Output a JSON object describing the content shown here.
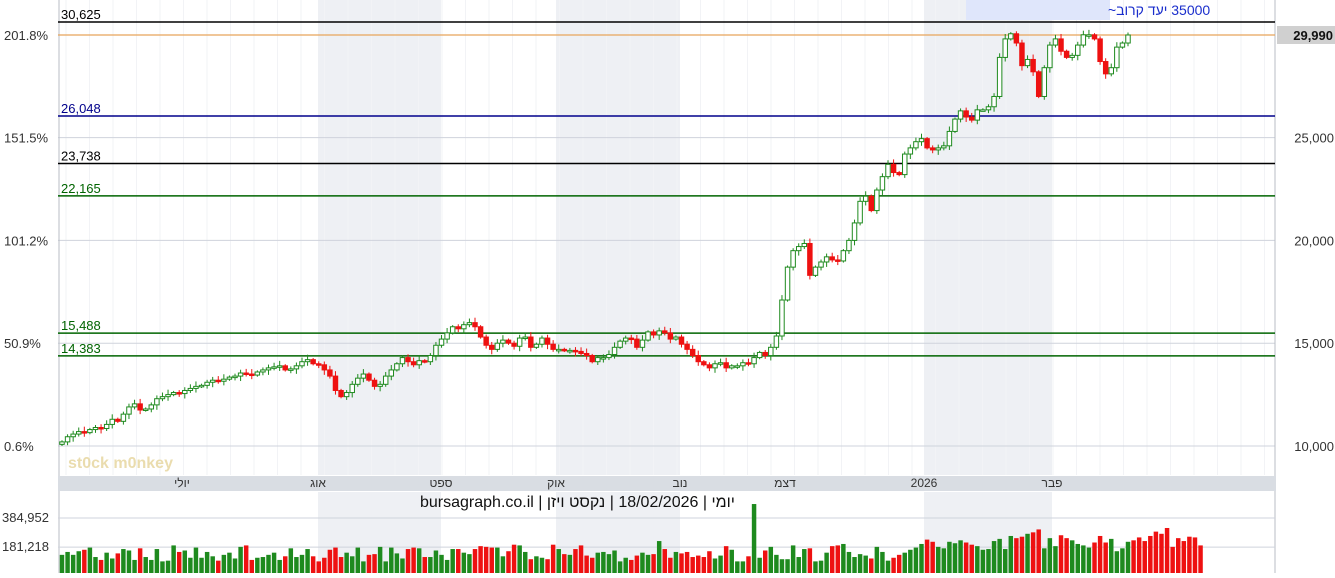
{
  "chart_data": {
    "type": "candlestick",
    "y_axis_right": {
      "ticks": [
        10000,
        15000,
        20000,
        25000,
        30000
      ],
      "tick_labels": [
        "10,000",
        "15,000",
        "20,000",
        "25,000",
        "29,990"
      ]
    },
    "y_axis_left": {
      "ticks": [
        10000,
        15000,
        20000,
        25000,
        29990
      ],
      "tick_labels": [
        "0.6%",
        "50.9%",
        "101.2%",
        "151.5%",
        "201.8%"
      ]
    },
    "ylim": [
      9900,
      30700
    ],
    "last_price": "29,990",
    "months": [
      "יולי",
      "אוג",
      "ספט",
      "אוק",
      "נוב",
      "דצמ",
      "2026",
      "פבר"
    ],
    "horizontal_levels": [
      {
        "value": 30625,
        "label": "30,625",
        "color": "#000000"
      },
      {
        "value": 26048,
        "label": "26,048",
        "color": "#00008b"
      },
      {
        "value": 23738,
        "label": "23,738",
        "color": "#000000"
      },
      {
        "value": 22165,
        "label": "22,165",
        "color": "#006400"
      },
      {
        "value": 15488,
        "label": "15,488",
        "color": "#006400"
      },
      {
        "value": 14383,
        "label": "14,383",
        "color": "#006400"
      }
    ],
    "highlight_level": {
      "value": 29990,
      "color": "#e8a55a"
    },
    "target_note": "35000 יעד קרוב~",
    "info_line": "יומי | 18/02/2026 | נקסט ויזן | bursagraph.co.il",
    "watermark": "st0ck m0nkey",
    "volume_ticks": {
      "labels": [
        "384,952",
        "181,218"
      ],
      "values": [
        384952,
        181218
      ]
    },
    "closes": [
      10200,
      10450,
      10580,
      10700,
      10650,
      10800,
      10900,
      10850,
      11050,
      11300,
      11200,
      11550,
      11900,
      12050,
      11750,
      11800,
      12000,
      12300,
      12400,
      12500,
      12600,
      12550,
      12700,
      12800,
      12900,
      12950,
      13100,
      13200,
      13150,
      13250,
      13350,
      13400,
      13550,
      13500,
      13450,
      13600,
      13700,
      13800,
      13850,
      13900,
      13700,
      13750,
      13900,
      14100,
      14200,
      14000,
      13950,
      13700,
      13400,
      12700,
      12400,
      12600,
      13000,
      13300,
      13500,
      13200,
      12900,
      13000,
      13400,
      13700,
      14000,
      14300,
      14100,
      13950,
      14150,
      14100,
      14400,
      14900,
      15200,
      15500,
      15800,
      15700,
      15900,
      16000,
      15800,
      15300,
      14900,
      14700,
      15000,
      15150,
      15000,
      14850,
      15250,
      15300,
      14800,
      14950,
      15250,
      14950,
      14700,
      14700,
      14650,
      14650,
      14600,
      14500,
      14400,
      14100,
      14300,
      14300,
      14450,
      14800,
      15100,
      15250,
      15200,
      14800,
      15150,
      15550,
      15400,
      15600,
      15500,
      15200,
      15300,
      14950,
      14700,
      14400,
      14100,
      13950,
      13800,
      14000,
      14050,
      13800,
      13900,
      13900,
      14050,
      14000,
      14300,
      14550,
      14400,
      14800,
      15350,
      17100,
      18700,
      19500,
      19700,
      19850,
      18300,
      18700,
      18950,
      19200,
      19050,
      19000,
      19500,
      20000,
      20850,
      21900,
      22150,
      21450,
      22450,
      23100,
      23700,
      23300,
      23200,
      24200,
      24500,
      24800,
      24950,
      24500,
      24400,
      24500,
      24600,
      25300,
      25900,
      26300,
      26000,
      25850,
      26350,
      26350,
      26500,
      27000,
      28900,
      29800,
      30050,
      29600,
      28500,
      28800,
      28200,
      27000,
      28400,
      29500,
      29800,
      29200,
      28900,
      29000,
      29500,
      30000,
      30000,
      29800,
      28700,
      28100,
      28400,
      29400,
      29600,
      29990
    ],
    "volumes": [
      25,
      29,
      25,
      30,
      32,
      35,
      22,
      18,
      28,
      20,
      27,
      33,
      31,
      18,
      34,
      22,
      18,
      33,
      16,
      17,
      38,
      29,
      31,
      21,
      35,
      21,
      29,
      23,
      17,
      25,
      28,
      20,
      36,
      38,
      18,
      21,
      22,
      25,
      28,
      18,
      23,
      34,
      22,
      25,
      33,
      23,
      16,
      21,
      32,
      35,
      22,
      28,
      23,
      35,
      16,
      25,
      26,
      36,
      16,
      35,
      27,
      20,
      33,
      35,
      34,
      22,
      22,
      31,
      25,
      18,
      33,
      33,
      28,
      26,
      33,
      37,
      36,
      35,
      35,
      23,
      30,
      39,
      38,
      29,
      19,
      23,
      21,
      19,
      39,
      33,
      26,
      25,
      33,
      38,
      24,
      21,
      28,
      29,
      26,
      31,
      16,
      21,
      18,
      24,
      28,
      25,
      26,
      44,
      33,
      21,
      29,
      27,
      29,
      22,
      24,
      22,
      30,
      20,
      24,
      37,
      32,
      16,
      16,
      23,
      18,
      21,
      31,
      36,
      25,
      19,
      19,
      38,
      22,
      33,
      34,
      16,
      17,
      28,
      37,
      38,
      40,
      29,
      22,
      26,
      24,
      20,
      36,
      29,
      17,
      21,
      25,
      28,
      32,
      35,
      40,
      46,
      43,
      36,
      34,
      43,
      41,
      45,
      42,
      39,
      37,
      32,
      33,
      44,
      47,
      33,
      51,
      48,
      50,
      54,
      56,
      60,
      34,
      48,
      37,
      52,
      48,
      45,
      40,
      38,
      35,
      42,
      51,
      42,
      47,
      30,
      34,
      43,
      45,
      49,
      44,
      51,
      57,
      54,
      62,
      36,
      48,
      44,
      50,
      49,
      38
    ]
  }
}
